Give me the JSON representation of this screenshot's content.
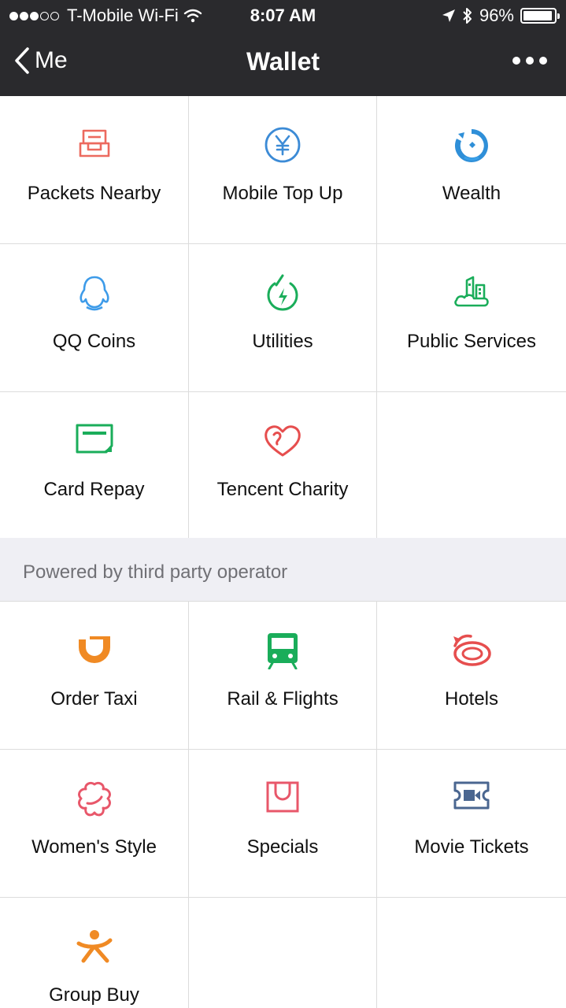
{
  "status_bar": {
    "carrier": "T-Mobile Wi-Fi",
    "time": "8:07 AM",
    "battery": "96%",
    "battery_level": 0.96
  },
  "nav": {
    "back_label": "Me",
    "title": "Wallet"
  },
  "tencent_services": [
    {
      "label": "Packets Nearby",
      "icon": "red-packet-icon",
      "color": "#ec6a5f"
    },
    {
      "label": "Mobile Top Up",
      "icon": "yen-coin-icon",
      "color": "#3c8bd6"
    },
    {
      "label": "Wealth",
      "icon": "wealth-icon",
      "color": "#2f8fd8"
    },
    {
      "label": "QQ Coins",
      "icon": "penguin-icon",
      "color": "#3d9be9"
    },
    {
      "label": "Utilities",
      "icon": "lightning-icon",
      "color": "#1aad5a"
    },
    {
      "label": "Public Services",
      "icon": "city-icon",
      "color": "#1aad5a"
    },
    {
      "label": "Card Repay",
      "icon": "card-icon",
      "color": "#1aad5a"
    },
    {
      "label": "Tencent Charity",
      "icon": "heart-icon",
      "color": "#e64e4e"
    }
  ],
  "section_header": "Powered by third party operator",
  "third_party_services": [
    {
      "label": "Order Taxi",
      "icon": "taxi-icon",
      "color": "#f08a24"
    },
    {
      "label": "Rail & Flights",
      "icon": "train-icon",
      "color": "#1aad5a"
    },
    {
      "label": "Hotels",
      "icon": "hotel-icon",
      "color": "#e64e4e"
    },
    {
      "label": "Women's Style",
      "icon": "flower-icon",
      "color": "#e8576a"
    },
    {
      "label": "Specials",
      "icon": "shopping-bag-icon",
      "color": "#e8576a"
    },
    {
      "label": "Movie Tickets",
      "icon": "ticket-icon",
      "color": "#4a6690"
    },
    {
      "label": "Group Buy",
      "icon": "group-buy-icon",
      "color": "#f08a24"
    }
  ]
}
